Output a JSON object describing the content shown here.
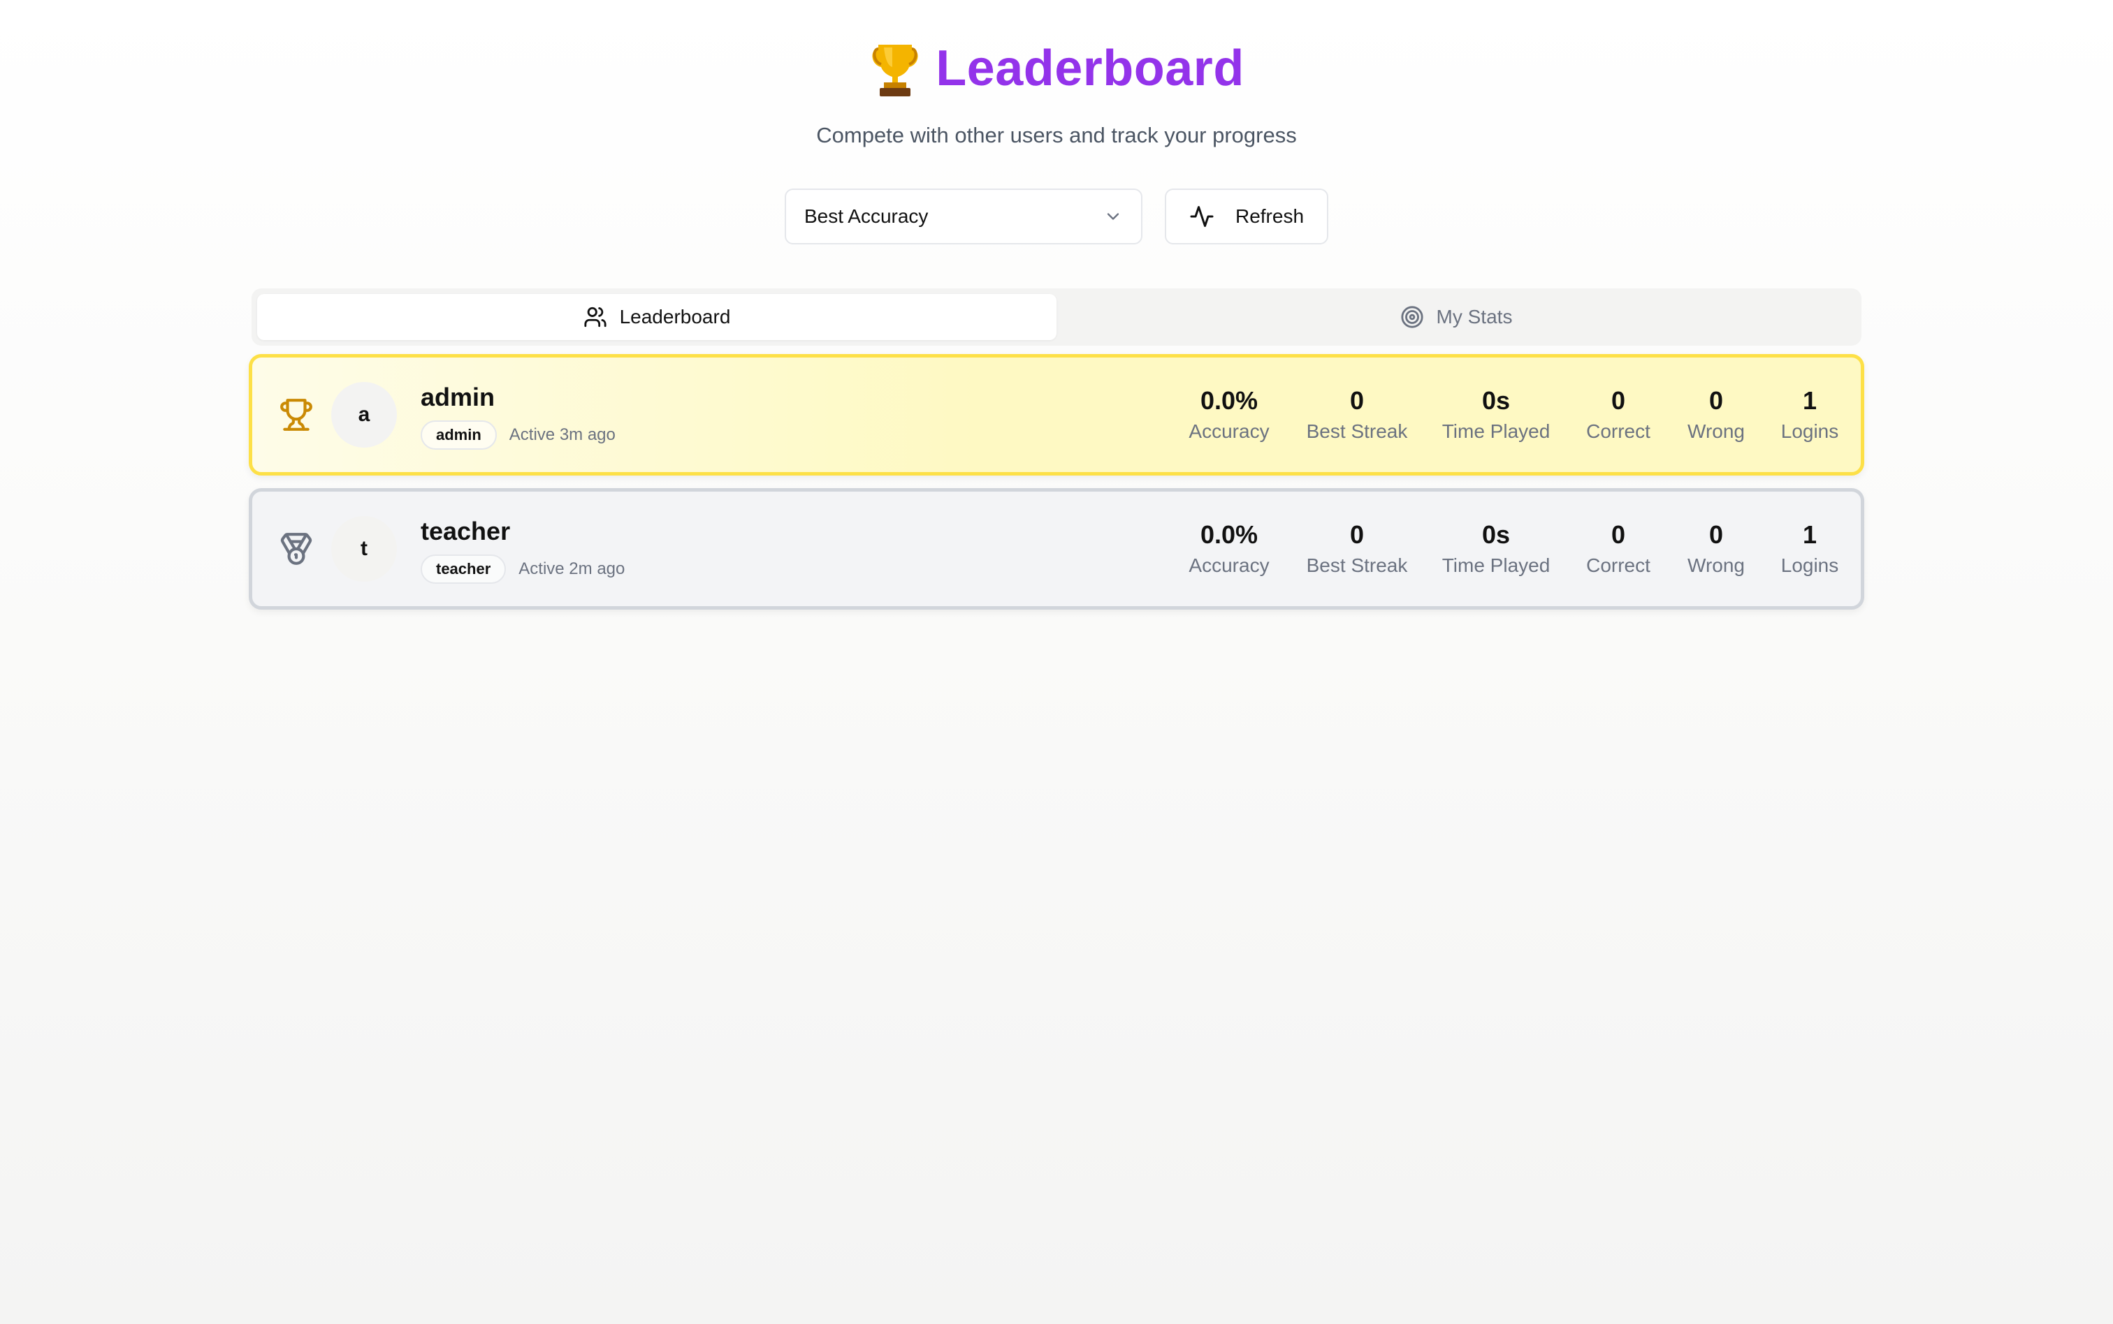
{
  "header": {
    "title": "Leaderboard",
    "subtitle": "Compete with other users and track your progress",
    "title_color": "#9333ea"
  },
  "controls": {
    "sort_select": {
      "value": "Best Accuracy"
    },
    "refresh_label": "Refresh"
  },
  "tabs": [
    {
      "label": "Leaderboard",
      "icon": "users-icon",
      "active": true
    },
    {
      "label": "My Stats",
      "icon": "target-icon",
      "active": false
    }
  ],
  "entries": [
    {
      "rank_icon": "trophy-icon",
      "avatar_letter": "a",
      "username": "admin",
      "role": "admin",
      "active": "Active 3m ago",
      "stats": [
        {
          "value": "0.0%",
          "label": "Accuracy"
        },
        {
          "value": "0",
          "label": "Best Streak"
        },
        {
          "value": "0s",
          "label": "Time Played"
        },
        {
          "value": "0",
          "label": "Correct"
        },
        {
          "value": "0",
          "label": "Wrong"
        },
        {
          "value": "1",
          "label": "Logins"
        }
      ]
    },
    {
      "rank_icon": "medal-icon",
      "avatar_letter": "t",
      "username": "teacher",
      "role": "teacher",
      "active": "Active 2m ago",
      "stats": [
        {
          "value": "0.0%",
          "label": "Accuracy"
        },
        {
          "value": "0",
          "label": "Best Streak"
        },
        {
          "value": "0s",
          "label": "Time Played"
        },
        {
          "value": "0",
          "label": "Correct"
        },
        {
          "value": "0",
          "label": "Wrong"
        },
        {
          "value": "1",
          "label": "Logins"
        }
      ]
    }
  ]
}
